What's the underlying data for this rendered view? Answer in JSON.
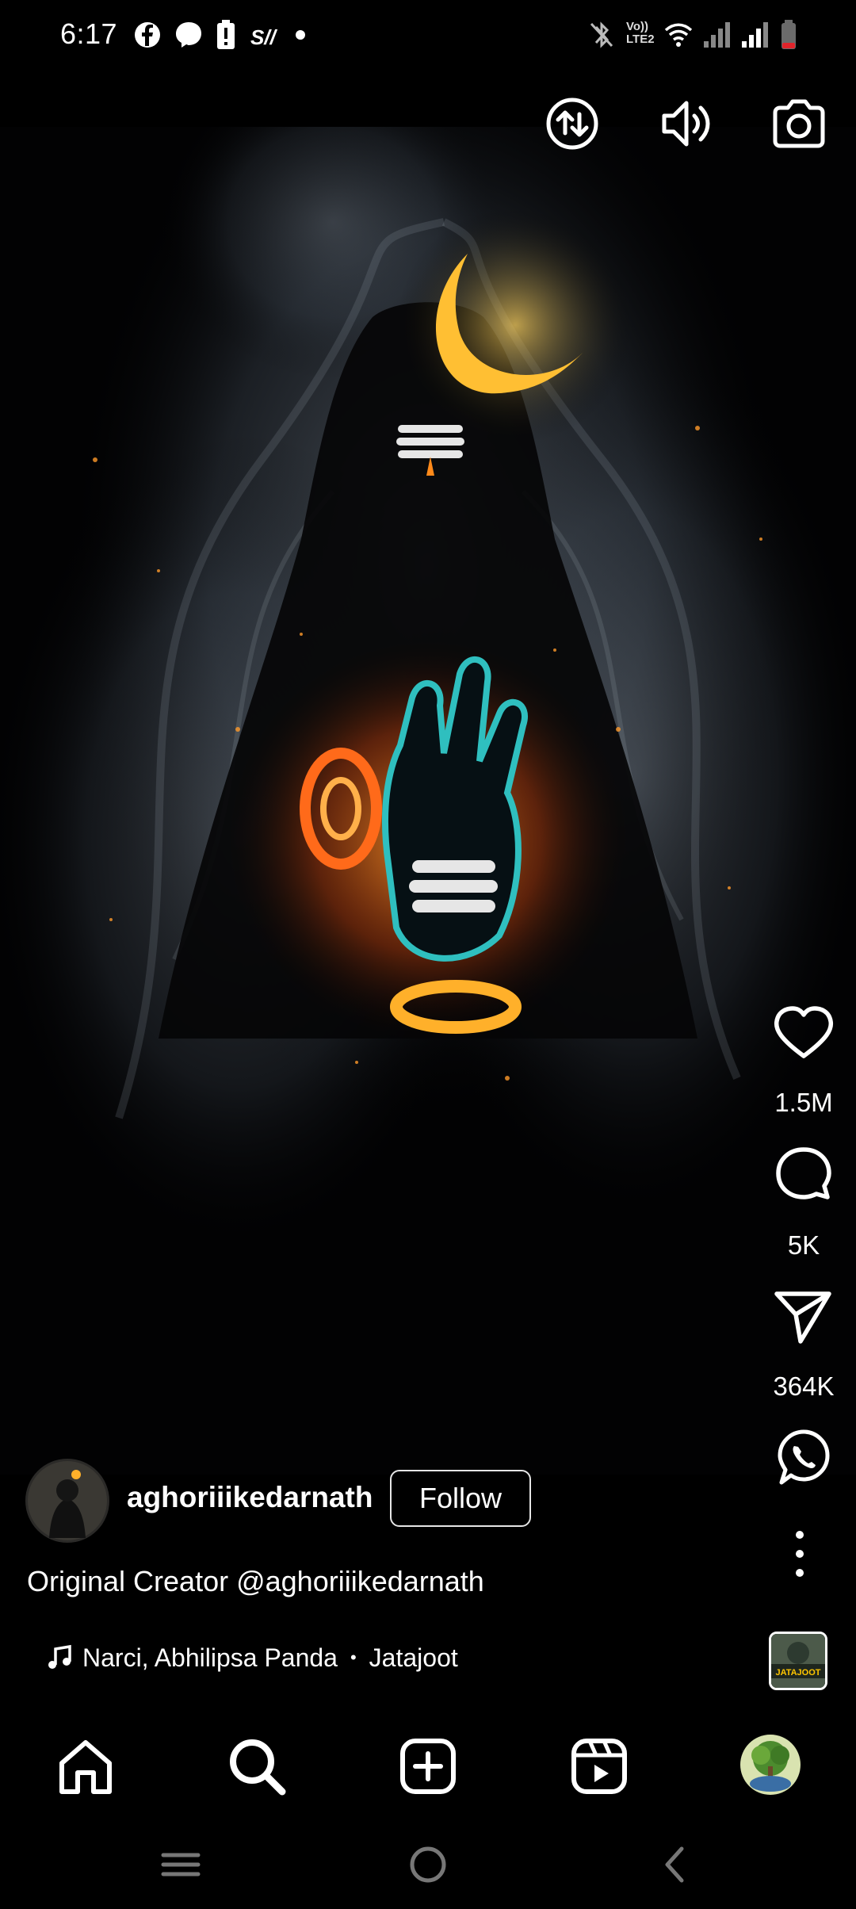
{
  "status_bar": {
    "time": "6:17",
    "network_label": "Vo)) LTE2"
  },
  "reel": {
    "likes": "1.5M",
    "comments": "5K",
    "shares": "364K",
    "creator": {
      "username": "aghoriiikedarnath",
      "follow_label": "Follow"
    },
    "caption": "Original Creator @aghoriiikedarnath",
    "audio": {
      "artists": "Narci, Abhilipsa Panda",
      "separator": "•",
      "track": "Jatajoot",
      "thumb_text": "JATAJOOT"
    }
  },
  "colors": {
    "background": "#000000",
    "text": "#ffffff",
    "fire": "#ff7a1a",
    "moon": "#ffc23a",
    "smoke": "#6f7d8c"
  },
  "icons": {
    "top": [
      "data-saver-icon",
      "volume-icon",
      "camera-icon"
    ],
    "rail": [
      "heart-icon",
      "comment-icon",
      "send-icon",
      "whatsapp-icon",
      "more-icon"
    ],
    "nav": [
      "home-icon",
      "search-icon",
      "create-icon",
      "reels-icon",
      "profile-avatar"
    ],
    "system": [
      "recents-icon",
      "home-circle-icon",
      "back-icon"
    ]
  }
}
